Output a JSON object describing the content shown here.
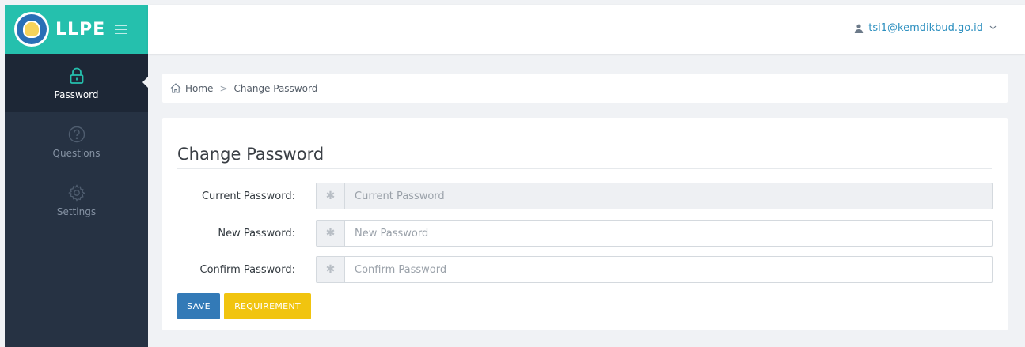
{
  "brand": {
    "name": "LLPE"
  },
  "sidebar": {
    "items": [
      {
        "label": "Password",
        "icon": "lock-icon",
        "active": true
      },
      {
        "label": "Questions",
        "icon": "question-circle-icon",
        "active": false
      },
      {
        "label": "Settings",
        "icon": "gear-icon",
        "active": false
      }
    ]
  },
  "topbar": {
    "user_email": "tsi1@kemdikbud.go.id"
  },
  "breadcrumb": {
    "home": "Home",
    "separator": ">",
    "current": "Change Password"
  },
  "form": {
    "title": "Change Password",
    "current_password": {
      "label": "Current Password:",
      "placeholder": "Current Password",
      "value": ""
    },
    "new_password": {
      "label": "New Password:",
      "placeholder": "New Password",
      "value": ""
    },
    "confirm_password": {
      "label": "Confirm Password:",
      "placeholder": "Confirm Password",
      "value": ""
    },
    "addon_symbol": "✱",
    "save_label": "SAVE",
    "requirement_label": "REQUIREMENT"
  },
  "colors": {
    "brand_teal": "#25c0ad",
    "sidebar_bg": "#263243",
    "save_blue": "#337ab7",
    "requirement_yellow": "#f1c40f",
    "link_blue": "#2c8fbf"
  }
}
